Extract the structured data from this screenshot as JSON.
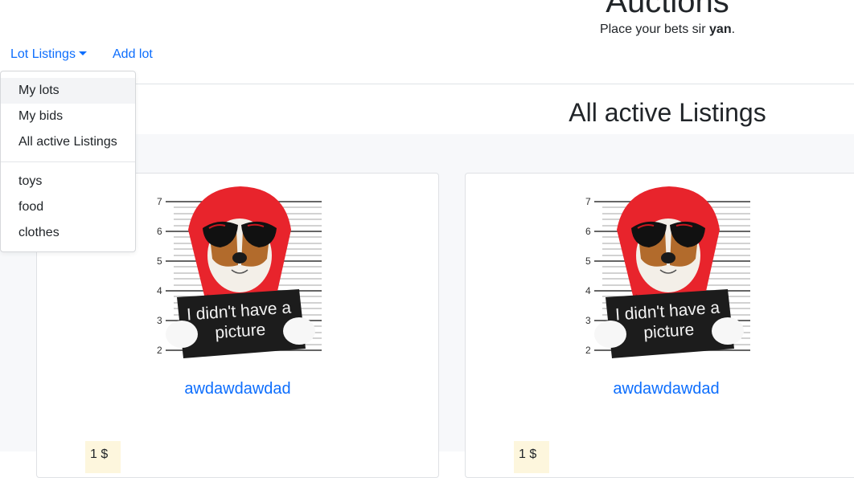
{
  "header": {
    "title": "Auctions",
    "tagline_prefix": "Place your bets sir ",
    "username": "yan",
    "tagline_suffix": "."
  },
  "nav": {
    "lot_listings": "Lot Listings",
    "add_lot": "Add lot"
  },
  "dropdown": {
    "items": [
      "My lots",
      "My bids",
      "All active Listings"
    ],
    "categories": [
      "toys",
      "food",
      "clothes"
    ]
  },
  "page": {
    "heading": "All active Listings"
  },
  "listings": [
    {
      "title": "awdawdawdad",
      "price": "1 $",
      "image": {
        "sign_line1": "I didn't have a",
        "sign_line2": "picture",
        "height_marks": [
          "7",
          "6",
          "5",
          "4",
          "3",
          "2"
        ]
      }
    },
    {
      "title": "awdawdawdad",
      "price": "1 $",
      "image": {
        "sign_line1": "I didn't have a",
        "sign_line2": "picture",
        "height_marks": [
          "7",
          "6",
          "5",
          "4",
          "3",
          "2"
        ]
      }
    }
  ],
  "colors": {
    "link": "#0d6efd",
    "hood": "#e8242c",
    "sign": "#1c1c1c",
    "price_badge_bg": "#fdf6dd"
  }
}
